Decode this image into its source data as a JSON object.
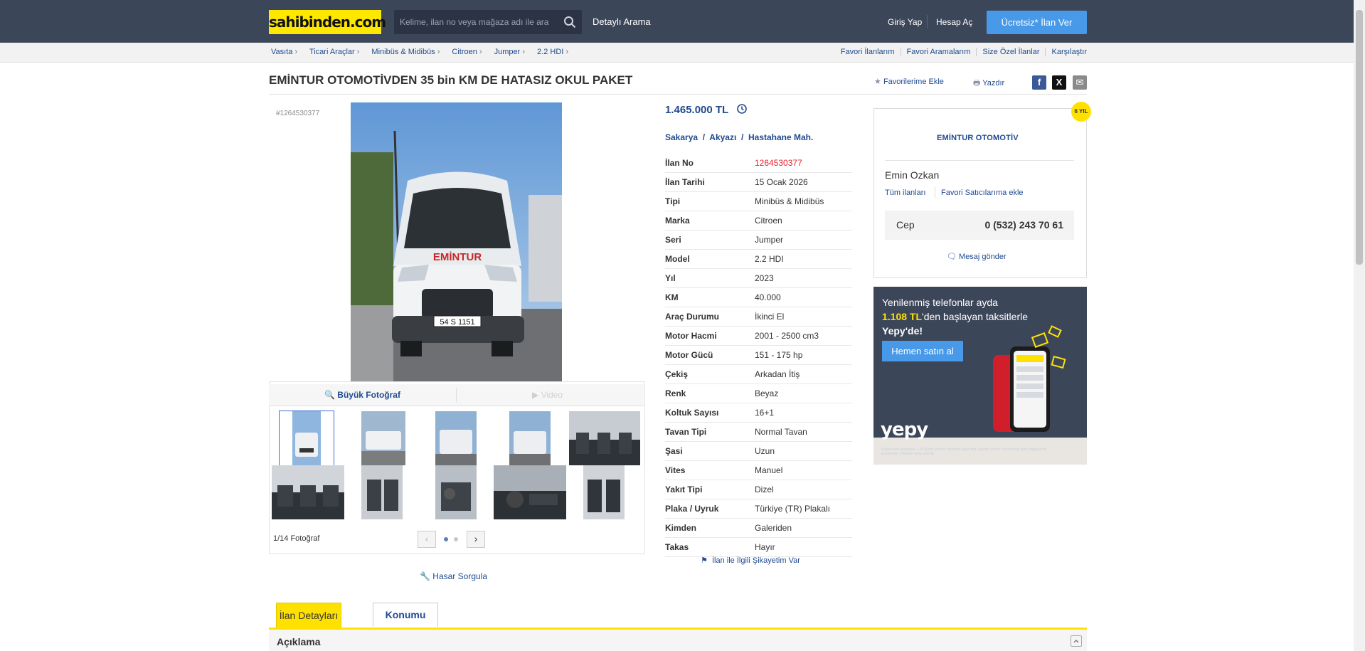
{
  "header": {
    "logo": "sahibinden.com",
    "search_placeholder": "Kelime, ilan no veya mağaza adı ile ara",
    "detailed_search": "Detaylı Arama",
    "login": "Giriş Yap",
    "register": "Hesap Aç",
    "post_ad": "Ücretsiz* İlan Ver"
  },
  "breadcrumb": [
    "Vasıta",
    "Ticari Araçlar",
    "Minibüs & Midibüs",
    "Citroen",
    "Jumper",
    "2.2 HDI"
  ],
  "top_links": [
    "Favori İlanlarım",
    "Favori Aramalarım",
    "Size Özel İlanlar",
    "Karşılaştır"
  ],
  "listing": {
    "title": "EMİNTUR OTOMOTİVDEN 35 bin KM DE HATASIZ OKUL PAKET",
    "add_favorite": "Favorilerime Ekle",
    "print": "Yazdır",
    "ad_id_label": "#1264530377",
    "plate": "54 S 1151",
    "decal": "EMİNTUR"
  },
  "gallery": {
    "big_photo": "Büyük Fotoğraf",
    "video": "Video",
    "count": "1/14 Fotoğraf",
    "damage_query": "Hasar Sorgula"
  },
  "info": {
    "price": "1.465.000 TL",
    "location": [
      "Sakarya",
      "Akyazı",
      "Hastahane Mah."
    ],
    "specs": [
      {
        "k": "İlan No",
        "v": "1264530377"
      },
      {
        "k": "İlan Tarihi",
        "v": "15 Ocak 2026"
      },
      {
        "k": "Tipi",
        "v": "Minibüs & Midibüs"
      },
      {
        "k": "Marka",
        "v": "Citroen"
      },
      {
        "k": "Seri",
        "v": "Jumper"
      },
      {
        "k": "Model",
        "v": "2.2 HDI"
      },
      {
        "k": "Yıl",
        "v": "2023"
      },
      {
        "k": "KM",
        "v": "40.000"
      },
      {
        "k": "Araç Durumu",
        "v": "İkinci El"
      },
      {
        "k": "Motor Hacmi",
        "v": "2001 - 2500 cm3"
      },
      {
        "k": "Motor Gücü",
        "v": "151 - 175 hp"
      },
      {
        "k": "Çekiş",
        "v": "Arkadan İtiş"
      },
      {
        "k": "Renk",
        "v": "Beyaz"
      },
      {
        "k": "Koltuk Sayısı",
        "v": "16+1"
      },
      {
        "k": "Tavan Tipi",
        "v": "Normal Tavan"
      },
      {
        "k": "Şasi",
        "v": "Uzun"
      },
      {
        "k": "Vites",
        "v": "Manuel"
      },
      {
        "k": "Yakıt Tipi",
        "v": "Dizel"
      },
      {
        "k": "Plaka / Uyruk",
        "v": "Türkiye (TR) Plakalı"
      },
      {
        "k": "Kimden",
        "v": "Galeriden"
      },
      {
        "k": "Takas",
        "v": "Hayır"
      }
    ],
    "complaint": "İlan ile İlgili Şikayetim Var"
  },
  "seller": {
    "badge": "6 YIL",
    "store": "EMİNTUR OTOMOTİV",
    "name": "Emin Ozkan",
    "all_ads": "Tüm ilanları",
    "add_favorite_seller": "Favori Satıcılarıma ekle",
    "phone_label": "Cep",
    "phone": "0 (532) 243 70 61",
    "message": "Mesaj gönder"
  },
  "banner": {
    "line1": "Yenilenmiş telefonlar ayda",
    "line2_bold": "1.108 TL",
    "line2_rest": "'den başlayan taksitlerle",
    "line3": "Yepy'de!",
    "button": "Hemen satın al",
    "logo": "yepy",
    "small": "*Seçili kredi kartlarına 1-28 Şubat tarihleri arasında geçerlidir. Fiyatlar zaman ve ürünlere göre değişkenlik gösterebilir. Detaylar yepy.com'da."
  },
  "tabs": {
    "details": "İlan Detayları",
    "location": "Konumu"
  },
  "description": {
    "title": "Açıklama"
  },
  "colors": {
    "header_bg": "#3c4659",
    "logo_yellow": "#ffe800",
    "primary_blue": "#489ae9",
    "link_blue": "#1f4a8f",
    "ad_no_red": "#e81f2a"
  }
}
